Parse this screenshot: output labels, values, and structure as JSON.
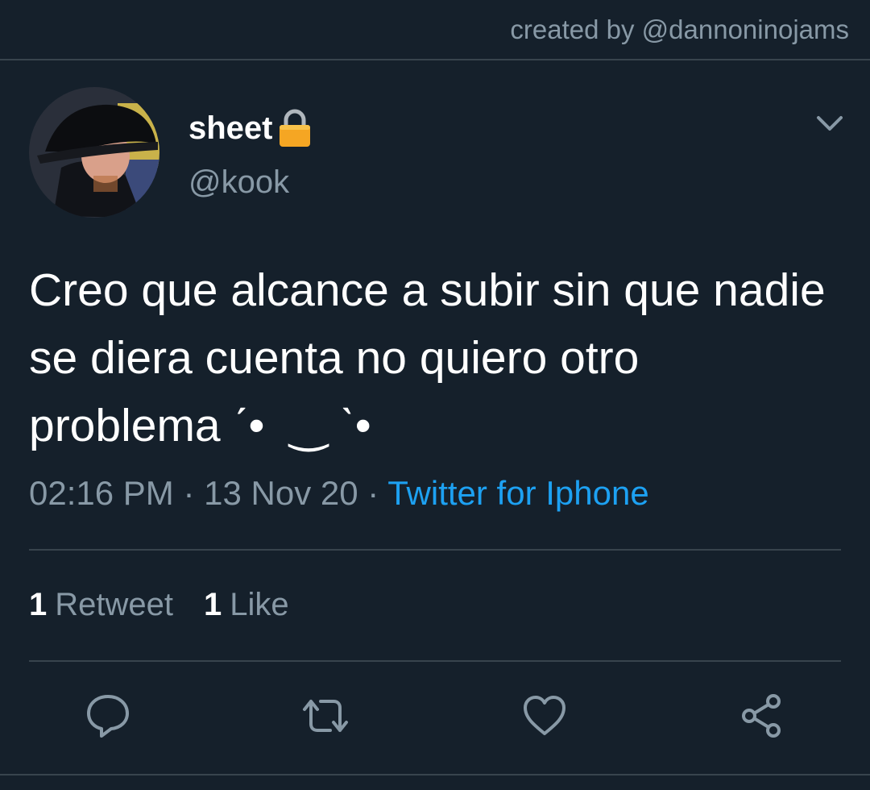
{
  "header": {
    "credit": "created by @dannoninojams"
  },
  "author": {
    "display_name": "sheet",
    "handle": "@kook",
    "avatar": "avatar-photo",
    "lock_icon": "lock-icon"
  },
  "tweet": {
    "text": "Creo que alcance a subir sin que nadie se diera cuenta no quiero otro problema ˊ•  ‿ ˋ•",
    "time": "02:16 PM",
    "date": "13 Nov 20",
    "separator": "·",
    "source": "Twitter for Iphone"
  },
  "stats": {
    "retweet_count": "1",
    "retweet_label": "Retweet",
    "like_count": "1",
    "like_label": "Like"
  },
  "actions": [
    {
      "icon": "reply-icon"
    },
    {
      "icon": "retweet-icon"
    },
    {
      "icon": "heart-icon"
    },
    {
      "icon": "share-icon"
    }
  ],
  "colors": {
    "background": "#15202b",
    "secondary_text": "#8899a6",
    "link": "#1da1f2",
    "divider": "#38444d"
  }
}
